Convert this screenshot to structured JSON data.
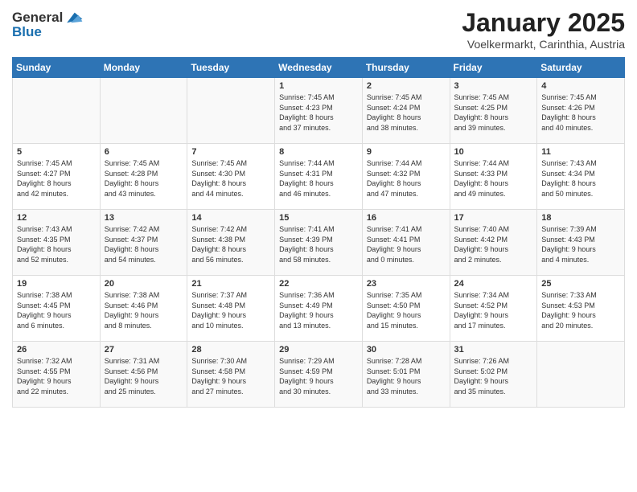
{
  "header": {
    "logo_line1": "General",
    "logo_line2": "Blue",
    "title": "January 2025",
    "subtitle": "Voelkermarkt, Carinthia, Austria"
  },
  "weekdays": [
    "Sunday",
    "Monday",
    "Tuesday",
    "Wednesday",
    "Thursday",
    "Friday",
    "Saturday"
  ],
  "weeks": [
    [
      {
        "day": "",
        "content": ""
      },
      {
        "day": "",
        "content": ""
      },
      {
        "day": "",
        "content": ""
      },
      {
        "day": "1",
        "content": "Sunrise: 7:45 AM\nSunset: 4:23 PM\nDaylight: 8 hours\nand 37 minutes."
      },
      {
        "day": "2",
        "content": "Sunrise: 7:45 AM\nSunset: 4:24 PM\nDaylight: 8 hours\nand 38 minutes."
      },
      {
        "day": "3",
        "content": "Sunrise: 7:45 AM\nSunset: 4:25 PM\nDaylight: 8 hours\nand 39 minutes."
      },
      {
        "day": "4",
        "content": "Sunrise: 7:45 AM\nSunset: 4:26 PM\nDaylight: 8 hours\nand 40 minutes."
      }
    ],
    [
      {
        "day": "5",
        "content": "Sunrise: 7:45 AM\nSunset: 4:27 PM\nDaylight: 8 hours\nand 42 minutes."
      },
      {
        "day": "6",
        "content": "Sunrise: 7:45 AM\nSunset: 4:28 PM\nDaylight: 8 hours\nand 43 minutes."
      },
      {
        "day": "7",
        "content": "Sunrise: 7:45 AM\nSunset: 4:30 PM\nDaylight: 8 hours\nand 44 minutes."
      },
      {
        "day": "8",
        "content": "Sunrise: 7:44 AM\nSunset: 4:31 PM\nDaylight: 8 hours\nand 46 minutes."
      },
      {
        "day": "9",
        "content": "Sunrise: 7:44 AM\nSunset: 4:32 PM\nDaylight: 8 hours\nand 47 minutes."
      },
      {
        "day": "10",
        "content": "Sunrise: 7:44 AM\nSunset: 4:33 PM\nDaylight: 8 hours\nand 49 minutes."
      },
      {
        "day": "11",
        "content": "Sunrise: 7:43 AM\nSunset: 4:34 PM\nDaylight: 8 hours\nand 50 minutes."
      }
    ],
    [
      {
        "day": "12",
        "content": "Sunrise: 7:43 AM\nSunset: 4:35 PM\nDaylight: 8 hours\nand 52 minutes."
      },
      {
        "day": "13",
        "content": "Sunrise: 7:42 AM\nSunset: 4:37 PM\nDaylight: 8 hours\nand 54 minutes."
      },
      {
        "day": "14",
        "content": "Sunrise: 7:42 AM\nSunset: 4:38 PM\nDaylight: 8 hours\nand 56 minutes."
      },
      {
        "day": "15",
        "content": "Sunrise: 7:41 AM\nSunset: 4:39 PM\nDaylight: 8 hours\nand 58 minutes."
      },
      {
        "day": "16",
        "content": "Sunrise: 7:41 AM\nSunset: 4:41 PM\nDaylight: 9 hours\nand 0 minutes."
      },
      {
        "day": "17",
        "content": "Sunrise: 7:40 AM\nSunset: 4:42 PM\nDaylight: 9 hours\nand 2 minutes."
      },
      {
        "day": "18",
        "content": "Sunrise: 7:39 AM\nSunset: 4:43 PM\nDaylight: 9 hours\nand 4 minutes."
      }
    ],
    [
      {
        "day": "19",
        "content": "Sunrise: 7:38 AM\nSunset: 4:45 PM\nDaylight: 9 hours\nand 6 minutes."
      },
      {
        "day": "20",
        "content": "Sunrise: 7:38 AM\nSunset: 4:46 PM\nDaylight: 9 hours\nand 8 minutes."
      },
      {
        "day": "21",
        "content": "Sunrise: 7:37 AM\nSunset: 4:48 PM\nDaylight: 9 hours\nand 10 minutes."
      },
      {
        "day": "22",
        "content": "Sunrise: 7:36 AM\nSunset: 4:49 PM\nDaylight: 9 hours\nand 13 minutes."
      },
      {
        "day": "23",
        "content": "Sunrise: 7:35 AM\nSunset: 4:50 PM\nDaylight: 9 hours\nand 15 minutes."
      },
      {
        "day": "24",
        "content": "Sunrise: 7:34 AM\nSunset: 4:52 PM\nDaylight: 9 hours\nand 17 minutes."
      },
      {
        "day": "25",
        "content": "Sunrise: 7:33 AM\nSunset: 4:53 PM\nDaylight: 9 hours\nand 20 minutes."
      }
    ],
    [
      {
        "day": "26",
        "content": "Sunrise: 7:32 AM\nSunset: 4:55 PM\nDaylight: 9 hours\nand 22 minutes."
      },
      {
        "day": "27",
        "content": "Sunrise: 7:31 AM\nSunset: 4:56 PM\nDaylight: 9 hours\nand 25 minutes."
      },
      {
        "day": "28",
        "content": "Sunrise: 7:30 AM\nSunset: 4:58 PM\nDaylight: 9 hours\nand 27 minutes."
      },
      {
        "day": "29",
        "content": "Sunrise: 7:29 AM\nSunset: 4:59 PM\nDaylight: 9 hours\nand 30 minutes."
      },
      {
        "day": "30",
        "content": "Sunrise: 7:28 AM\nSunset: 5:01 PM\nDaylight: 9 hours\nand 33 minutes."
      },
      {
        "day": "31",
        "content": "Sunrise: 7:26 AM\nSunset: 5:02 PM\nDaylight: 9 hours\nand 35 minutes."
      },
      {
        "day": "",
        "content": ""
      }
    ]
  ]
}
